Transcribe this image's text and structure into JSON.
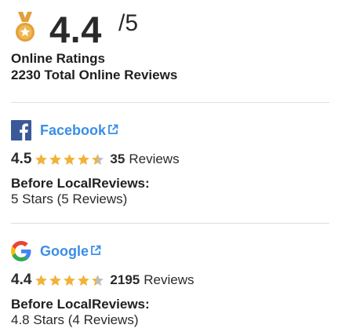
{
  "overall": {
    "rating": "4.4",
    "out_of": "/5",
    "label": "Online Ratings",
    "total": "2230 Total Online Reviews",
    "medal_color": "#e2a03a"
  },
  "sources": [
    {
      "name": "Facebook",
      "icon": "facebook-logo-icon",
      "rating": "4.5",
      "stars": 4.5,
      "count": "35",
      "reviews_word": "Reviews",
      "before_label": "Before LocalReviews:",
      "before_value": "5 Stars (5 Reviews)"
    },
    {
      "name": "Google",
      "icon": "google-logo-icon",
      "rating": "4.4",
      "stars": 4.4,
      "count": "2195",
      "reviews_word": "Reviews",
      "before_label": "Before LocalReviews:",
      "before_value": "4.8 Stars (4 Reviews)"
    }
  ],
  "colors": {
    "link": "#3a8ee6",
    "star_filled": "#f2b23a",
    "star_empty": "#bdbdbd",
    "facebook_blue": "#3b5998"
  }
}
